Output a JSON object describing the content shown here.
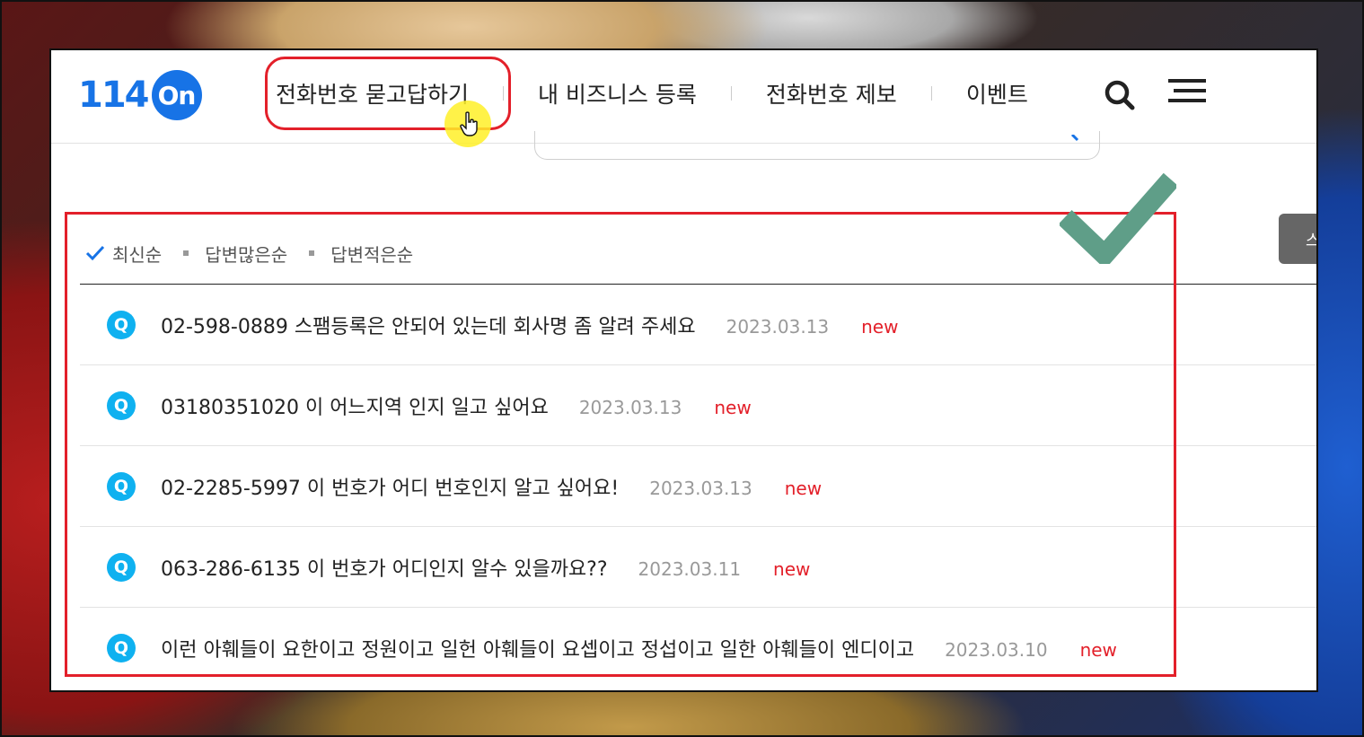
{
  "header": {
    "logo_number": "114",
    "logo_circle": "On",
    "nav": [
      {
        "label": "전화번호 묻고답하기"
      },
      {
        "label": "내 비즈니스 등록"
      },
      {
        "label": "전화번호 제보"
      },
      {
        "label": "이벤트"
      }
    ],
    "icons": {
      "search": "search-icon",
      "menu": "hamburger-menu-icon"
    }
  },
  "side_tab": {
    "label": "스"
  },
  "sort": {
    "options": [
      "최신순",
      "답변많은순",
      "답변적은순"
    ],
    "selected": "최신순"
  },
  "questions": [
    {
      "badge": "Q",
      "title": "02-598-0889 스팸등록은 안되어 있는데 회사명 좀 알려 주세요",
      "date": "2023.03.13",
      "tag": "new"
    },
    {
      "badge": "Q",
      "title": "03180351020  이 어느지역 인지 일고 싶어요",
      "date": "2023.03.13",
      "tag": "new"
    },
    {
      "badge": "Q",
      "title": "02-2285-5997 이 번호가 어디 번호인지 알고 싶어요!",
      "date": "2023.03.13",
      "tag": "new"
    },
    {
      "badge": "Q",
      "title": "063-286-6135 이 번호가 어디인지 알수 있을까요??",
      "date": "2023.03.11",
      "tag": "new"
    },
    {
      "badge": "Q",
      "title": "이런 아훼들이 요한이고 정원이고 일헌 아훼들이 요셉이고 정섭이고 일한 아훼들이 엔디이고",
      "date": "2023.03.10",
      "tag": "new"
    }
  ],
  "colors": {
    "brand": "#1773e6",
    "q_badge": "#0fb1f0",
    "annotation_red": "#e3202a",
    "annotation_check": "#5f9e88",
    "new_tag": "#e3202a"
  }
}
